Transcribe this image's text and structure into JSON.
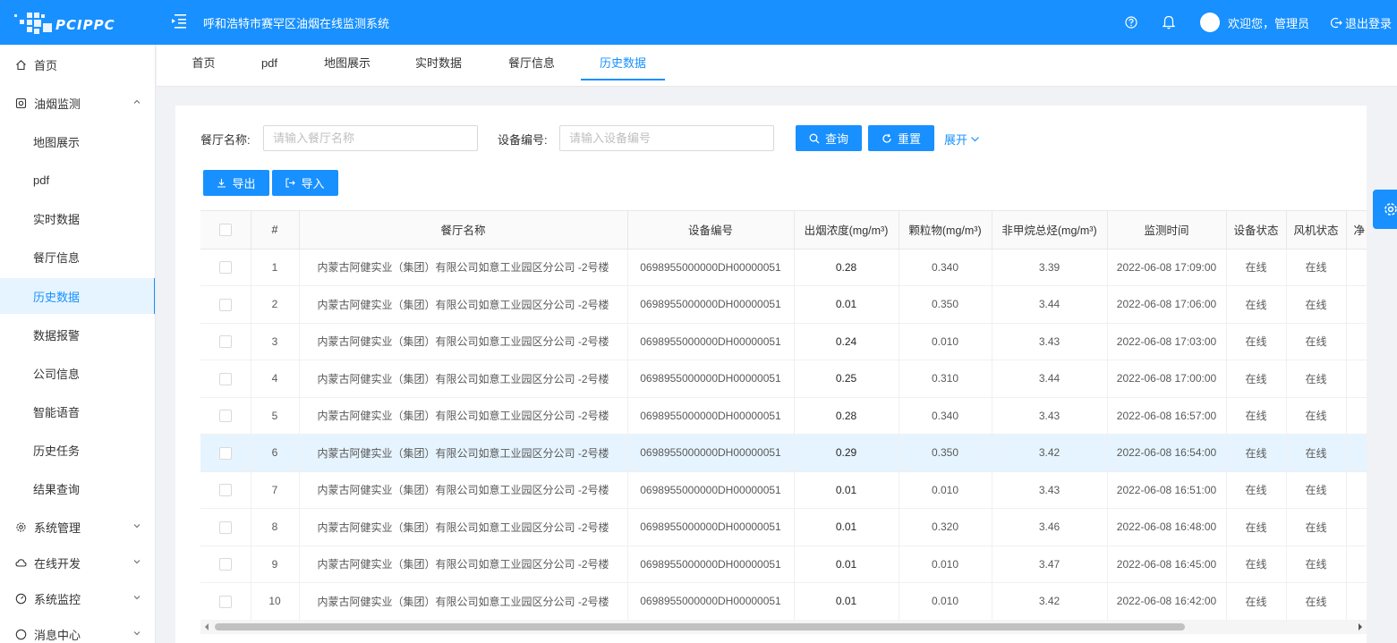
{
  "header": {
    "logo_text": "PCIPPC",
    "system_title": "呼和浩特市赛罕区油烟在线监测系统",
    "welcome": "欢迎您，管理员",
    "logout_label": "退出登录",
    "color": "#1890ff"
  },
  "sidebar": {
    "home": "首页",
    "oil_monitor": "油烟监测",
    "sub_items": [
      "地图展示",
      "pdf",
      "实时数据",
      "餐厅信息",
      "历史数据",
      "数据报警",
      "公司信息",
      "智能语音",
      "历史任务",
      "结果查询"
    ],
    "active_sub": "历史数据",
    "system_mgmt": "系统管理",
    "online_dev": "在线开发",
    "system_monitor": "系统监控",
    "message_center": "消息中心"
  },
  "tabs": [
    "首页",
    "pdf",
    "地图展示",
    "实时数据",
    "餐厅信息",
    "历史数据"
  ],
  "active_tab": "历史数据",
  "search": {
    "restaurant_label": "餐厅名称:",
    "restaurant_placeholder": "请输入餐厅名称",
    "device_label": "设备编号:",
    "device_placeholder": "请输入设备编号",
    "query_label": "查询",
    "reset_label": "重置",
    "expand_label": "展开"
  },
  "actions": {
    "export_label": "导出",
    "import_label": "导入"
  },
  "table": {
    "columns": [
      "#",
      "餐厅名称",
      "设备编号",
      "出烟浓度(mg/m³)",
      "颗粒物(mg/m³)",
      "非甲烷总烃(mg/m³)",
      "监测时间",
      "设备状态",
      "风机状态",
      "净"
    ],
    "highlighted_row": 6,
    "rows": [
      {
        "idx": "1",
        "name": "内蒙古阿健实业（集团）有限公司如意工业园区分公司 -2号楼",
        "device": "0698955000000DH00000051",
        "smoke": "0.28",
        "pm": "0.340",
        "nmhc": "3.39",
        "time": "2022-06-08 17:09:00",
        "dev_status": "在线",
        "fan_status": "在线"
      },
      {
        "idx": "2",
        "name": "内蒙古阿健实业（集团）有限公司如意工业园区分公司 -2号楼",
        "device": "0698955000000DH00000051",
        "smoke": "0.01",
        "pm": "0.350",
        "nmhc": "3.44",
        "time": "2022-06-08 17:06:00",
        "dev_status": "在线",
        "fan_status": "在线"
      },
      {
        "idx": "3",
        "name": "内蒙古阿健实业（集团）有限公司如意工业园区分公司 -2号楼",
        "device": "0698955000000DH00000051",
        "smoke": "0.24",
        "pm": "0.010",
        "nmhc": "3.43",
        "time": "2022-06-08 17:03:00",
        "dev_status": "在线",
        "fan_status": "在线"
      },
      {
        "idx": "4",
        "name": "内蒙古阿健实业（集团）有限公司如意工业园区分公司 -2号楼",
        "device": "0698955000000DH00000051",
        "smoke": "0.25",
        "pm": "0.310",
        "nmhc": "3.44",
        "time": "2022-06-08 17:00:00",
        "dev_status": "在线",
        "fan_status": "在线"
      },
      {
        "idx": "5",
        "name": "内蒙古阿健实业（集团）有限公司如意工业园区分公司 -2号楼",
        "device": "0698955000000DH00000051",
        "smoke": "0.28",
        "pm": "0.340",
        "nmhc": "3.43",
        "time": "2022-06-08 16:57:00",
        "dev_status": "在线",
        "fan_status": "在线"
      },
      {
        "idx": "6",
        "name": "内蒙古阿健实业（集团）有限公司如意工业园区分公司 -2号楼",
        "device": "0698955000000DH00000051",
        "smoke": "0.29",
        "pm": "0.350",
        "nmhc": "3.42",
        "time": "2022-06-08 16:54:00",
        "dev_status": "在线",
        "fan_status": "在线"
      },
      {
        "idx": "7",
        "name": "内蒙古阿健实业（集团）有限公司如意工业园区分公司 -2号楼",
        "device": "0698955000000DH00000051",
        "smoke": "0.01",
        "pm": "0.010",
        "nmhc": "3.43",
        "time": "2022-06-08 16:51:00",
        "dev_status": "在线",
        "fan_status": "在线"
      },
      {
        "idx": "8",
        "name": "内蒙古阿健实业（集团）有限公司如意工业园区分公司 -2号楼",
        "device": "0698955000000DH00000051",
        "smoke": "0.01",
        "pm": "0.320",
        "nmhc": "3.46",
        "time": "2022-06-08 16:48:00",
        "dev_status": "在线",
        "fan_status": "在线"
      },
      {
        "idx": "9",
        "name": "内蒙古阿健实业（集团）有限公司如意工业园区分公司 -2号楼",
        "device": "0698955000000DH00000051",
        "smoke": "0.01",
        "pm": "0.010",
        "nmhc": "3.47",
        "time": "2022-06-08 16:45:00",
        "dev_status": "在线",
        "fan_status": "在线"
      },
      {
        "idx": "10",
        "name": "内蒙古阿健实业（集团）有限公司如意工业园区分公司 -2号楼",
        "device": "0698955000000DH00000051",
        "smoke": "0.01",
        "pm": "0.010",
        "nmhc": "3.42",
        "time": "2022-06-08 16:42:00",
        "dev_status": "在线",
        "fan_status": "在线"
      }
    ]
  }
}
